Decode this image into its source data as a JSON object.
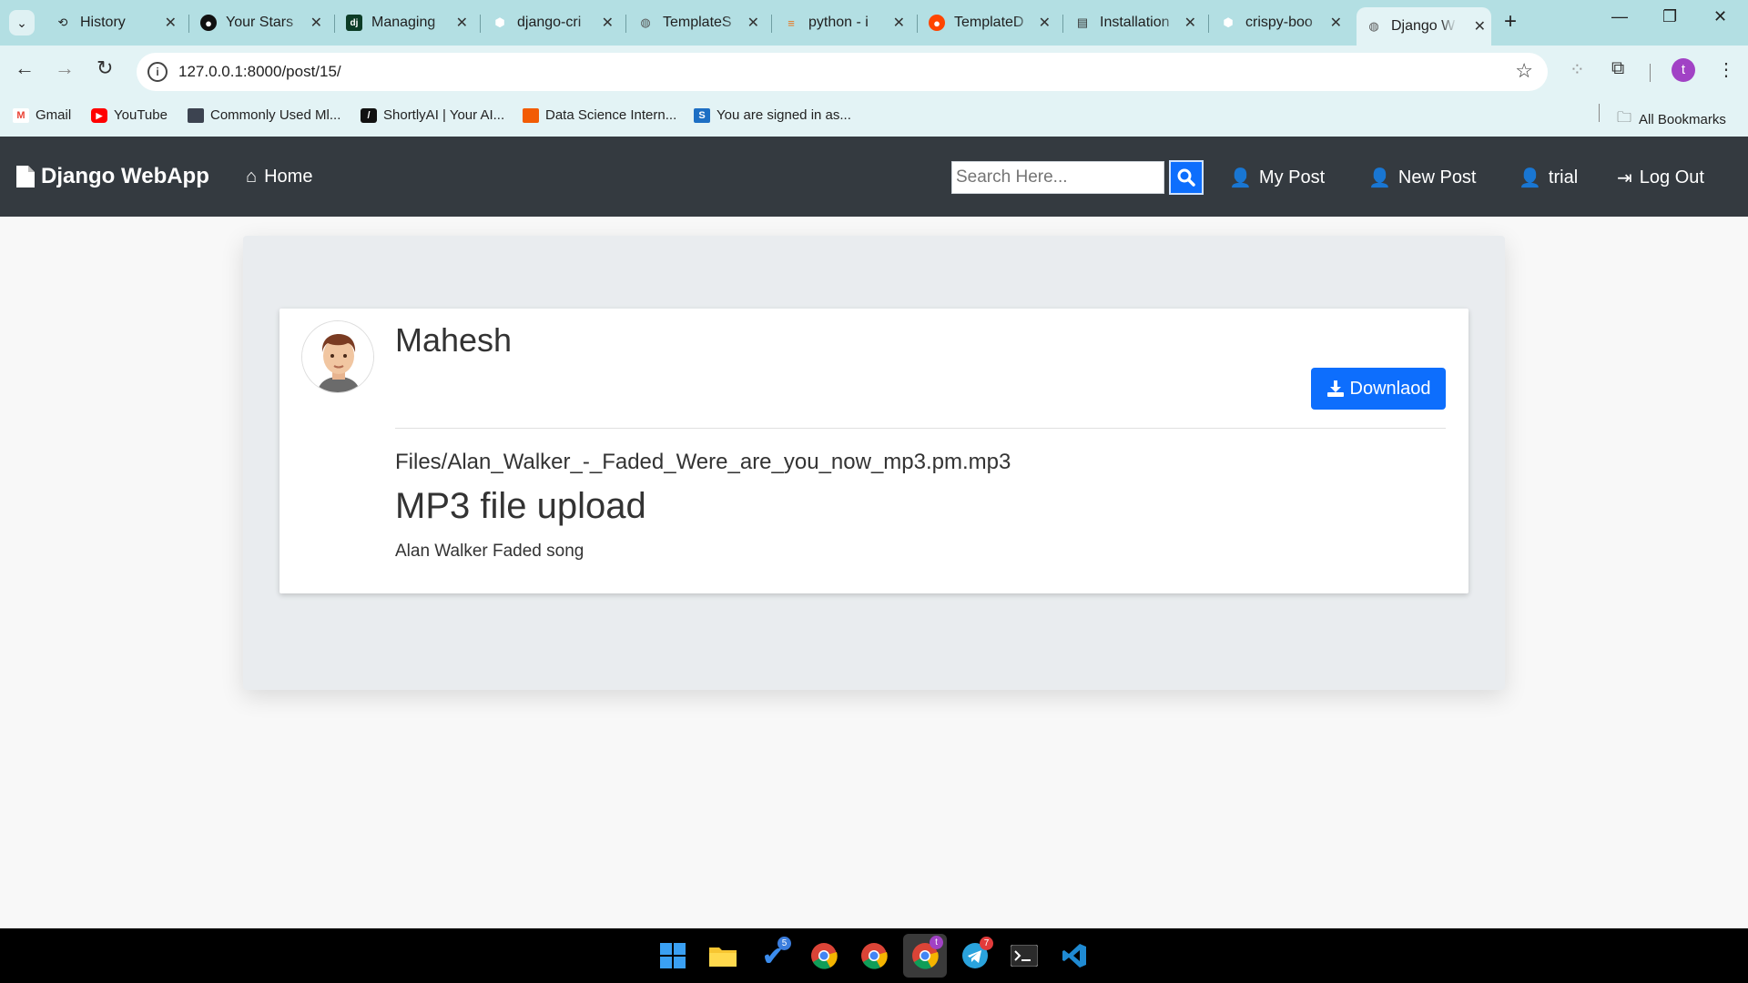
{
  "browser": {
    "tabs": [
      {
        "title": "History",
        "icon": "history-icon"
      },
      {
        "title": "Your Stars",
        "icon": "github-icon"
      },
      {
        "title": "Managing",
        "icon": "django-icon"
      },
      {
        "title": "django-cri",
        "icon": "cube-icon"
      },
      {
        "title": "TemplateS",
        "icon": "globe-icon"
      },
      {
        "title": "python - i",
        "icon": "stackoverflow-icon"
      },
      {
        "title": "TemplateD",
        "icon": "reddit-icon"
      },
      {
        "title": "Installation",
        "icon": "docs-icon"
      },
      {
        "title": "crispy-boo",
        "icon": "cube-icon"
      },
      {
        "title": "Django W",
        "icon": "globe-icon"
      }
    ],
    "url": "127.0.0.1:8000/post/15/",
    "profile_initial": "t",
    "bookmarks": [
      {
        "label": "Gmail",
        "icon": "gmail-icon"
      },
      {
        "label": "YouTube",
        "icon": "youtube-icon"
      },
      {
        "label": "Commonly Used Ml...",
        "icon": "monitor-icon"
      },
      {
        "label": "ShortlyAI | Your AI...",
        "icon": "shortlyai-icon"
      },
      {
        "label": "Data Science Intern...",
        "icon": "data-science-icon"
      },
      {
        "label": "You are signed in as...",
        "icon": "s-icon"
      }
    ],
    "all_bookmarks": "All Bookmarks"
  },
  "navbar": {
    "brand": "Django WebApp",
    "home": "Home",
    "search_placeholder": "Search Here...",
    "my_post": "My Post",
    "new_post": "New Post",
    "user": "trial",
    "logout": "Log Out"
  },
  "post": {
    "author": "Mahesh",
    "download_label": "Downlaod",
    "file_path": "Files/Alan_Walker_-_Faded_Were_are_you_now_mp3.pm.mp3",
    "title": "MP3 file upload",
    "description": "Alan Walker Faded song"
  },
  "taskbar": {
    "badges": {
      "todo": "5",
      "chrome_profile": "t",
      "telegram": "7"
    }
  },
  "colors": {
    "tab_strip": "#b3dfe3",
    "toolbar": "#e3f3f5",
    "navbar": "#343a40",
    "primary": "#0d6efd"
  }
}
